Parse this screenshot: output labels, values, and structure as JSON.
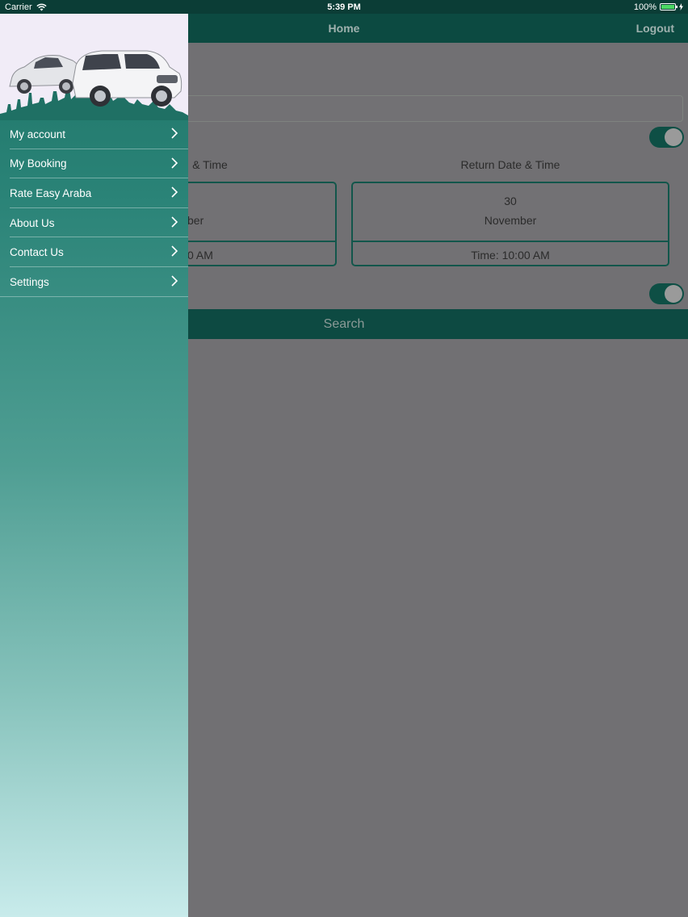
{
  "status_bar": {
    "carrier": "Carrier",
    "time": "5:39 PM",
    "battery_percent": "100%",
    "battery_level": 1.0,
    "icons": [
      "wifi-icon",
      "battery-icon",
      "charging-icon"
    ]
  },
  "nav": {
    "title": "Home",
    "logout_label": "Logout"
  },
  "main": {
    "toggle_1_on": true,
    "toggle_2_on": true,
    "pickup": {
      "label_visible": "& Time",
      "month_visible": "ber",
      "time_visible": "0 AM"
    },
    "return": {
      "label": "Return Date & Time",
      "day": "30",
      "month": "November",
      "time": "Time: 10:00 AM"
    },
    "search_label": "Search"
  },
  "drawer": {
    "menu": [
      {
        "label": "My account"
      },
      {
        "label": "My Booking"
      },
      {
        "label": "Rate Easy Araba"
      },
      {
        "label": "About Us"
      },
      {
        "label": "Contact Us"
      },
      {
        "label": "Settings"
      }
    ],
    "chevron_icon": "chevron-right-icon"
  },
  "colors": {
    "primary_dark": "#0c4a41",
    "drawer_top": "#1e7467",
    "drawer_bottom": "#c8ebeb",
    "toggle_on": "#0e4f45"
  }
}
